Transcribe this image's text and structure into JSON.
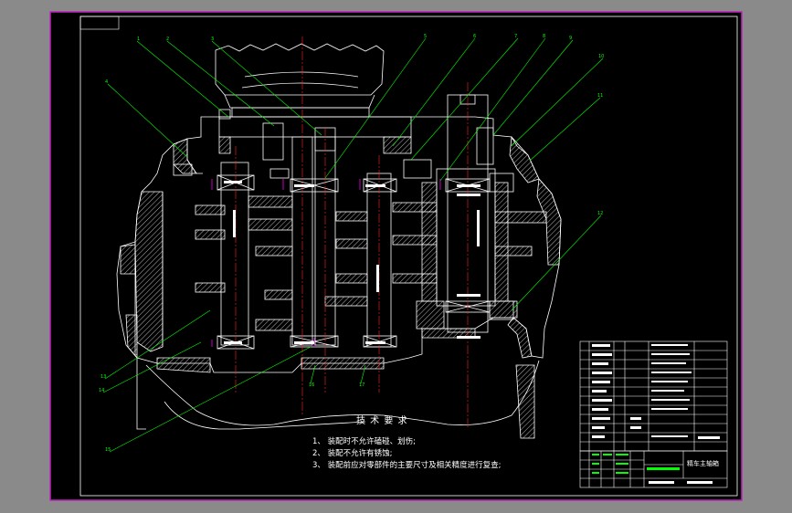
{
  "drawing": {
    "technical_requirements_title": "技 术 要 求",
    "technical_requirements": [
      "1、 装配时不允许磕碰、划伤;",
      "2、 装配不允许有锈蚀;",
      "3、 装配前应对零部件的主要尺寸及相关精度进行复查;"
    ],
    "title_block": {
      "drawing_name": "精车主轴箱"
    }
  },
  "colors": {
    "background": "#000000",
    "viewport_surround": "#8a8a8a",
    "border": "#c020c0",
    "frame": "#ffffff",
    "leader": "#00ff00",
    "centerline": "#ff2020",
    "hatch": "#ffffff",
    "highlight": "#c000c0"
  }
}
